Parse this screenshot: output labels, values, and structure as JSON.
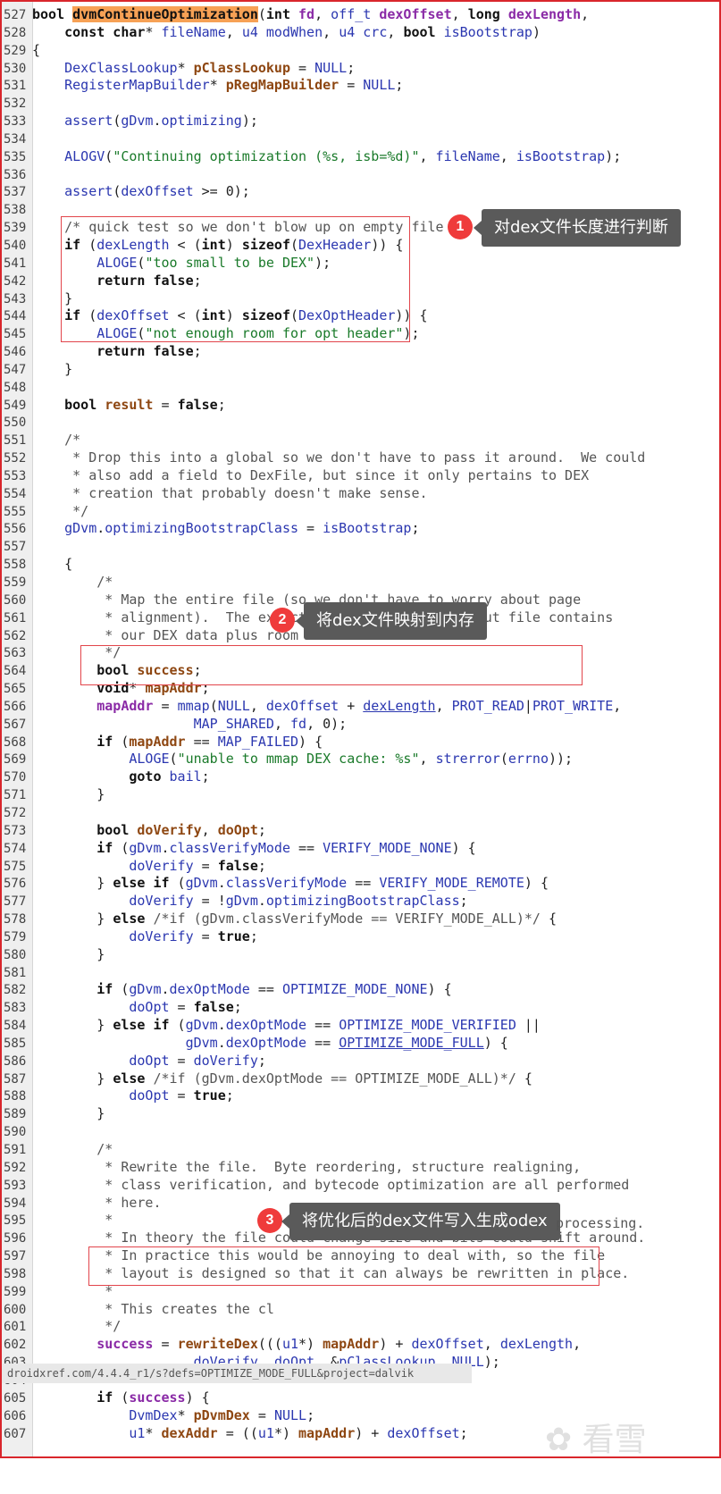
{
  "code_lines": [
    {
      "n": "527",
      "h": "<span class='k'>bool</span> <span class='fhl'>dvmContinueOptimization</span>(<span class='k'>int</span> <span class='v'>fd</span>, <span class='p'>off_t</span> <span class='v'>dexOffset</span>, <span class='k'>long</span> <span class='v'>dexLength</span>,"
    },
    {
      "n": "528",
      "h": "    <span class='k'>const char</span>* <span class='p'>fileName</span>, <span class='p'>u4 modWhen</span>, <span class='p'>u4 crc</span>, <span class='k'>bool</span> <span class='p'>isBootstrap</span>)"
    },
    {
      "n": "529",
      "h": "{"
    },
    {
      "n": "530",
      "h": "    <span class='p'>DexClassLookup</span>* <span class='f'>pClassLookup</span> = <span class='m'>NULL</span>;"
    },
    {
      "n": "531",
      "h": "    <span class='p'>RegisterMapBuilder</span>* <span class='f'>pRegMapBuilder</span> = <span class='m'>NULL</span>;"
    },
    {
      "n": "532",
      "h": ""
    },
    {
      "n": "533",
      "h": "    <span class='p'>assert</span>(<span class='p'>gDvm</span>.<span class='p'>optimizing</span>);"
    },
    {
      "n": "534",
      "h": ""
    },
    {
      "n": "535",
      "h": "    <span class='p'>ALOGV</span>(<span class='s'>\"Continuing optimization (%s, isb=%d)\"</span>, <span class='p'>fileName</span>, <span class='p'>isBootstrap</span>);"
    },
    {
      "n": "536",
      "h": ""
    },
    {
      "n": "537",
      "h": "    <span class='p'>assert</span>(<span class='p'>dexOffset</span> >= 0);"
    },
    {
      "n": "538",
      "h": ""
    },
    {
      "n": "539",
      "h": "    <span class='c'>/* quick test so we don't blow up on empty file */</span>"
    },
    {
      "n": "540",
      "h": "    <span class='k'>if</span> (<span class='p'>dexLength</span> &lt; (<span class='k'>int</span>) <span class='k'>sizeof</span>(<span class='p'>DexHeader</span>)) {"
    },
    {
      "n": "541",
      "h": "        <span class='p'>ALOGE</span>(<span class='s'>\"too small to be DEX\"</span>);"
    },
    {
      "n": "542",
      "h": "        <span class='k'>return false</span>;"
    },
    {
      "n": "543",
      "h": "    }"
    },
    {
      "n": "544",
      "h": "    <span class='k'>if</span> (<span class='p'>dexOffset</span> &lt; (<span class='k'>int</span>) <span class='k'>sizeof</span>(<span class='p'>DexOptHeader</span>)) {"
    },
    {
      "n": "545",
      "h": "        <span class='p'>ALOGE</span>(<span class='s'>\"not enough room for opt header\"</span>);"
    },
    {
      "n": "546",
      "h": "        <span class='k'>return false</span>;"
    },
    {
      "n": "547",
      "h": "    }"
    },
    {
      "n": "548",
      "h": ""
    },
    {
      "n": "549",
      "h": "    <span class='k'>bool</span> <span class='f'>result</span> = <span class='k'>false</span>;"
    },
    {
      "n": "550",
      "h": ""
    },
    {
      "n": "551",
      "h": "    <span class='c'>/*</span>"
    },
    {
      "n": "552",
      "h": "    <span class='c'> * Drop this into a global so we don't have to pass it around.  We could</span>"
    },
    {
      "n": "553",
      "h": "    <span class='c'> * also add a field to DexFile, but since it only pertains to DEX</span>"
    },
    {
      "n": "554",
      "h": "    <span class='c'> * creation that probably doesn't make sense.</span>"
    },
    {
      "n": "555",
      "h": "    <span class='c'> */</span>"
    },
    {
      "n": "556",
      "h": "    <span class='p'>gDvm</span>.<span class='p'>optimizingBootstrapClass</span> = <span class='p'>isBootstrap</span>;"
    },
    {
      "n": "557",
      "h": ""
    },
    {
      "n": "558",
      "h": "    {"
    },
    {
      "n": "559",
      "h": "        <span class='c'>/*</span>"
    },
    {
      "n": "560",
      "h": "        <span class='c'> * Map the entire file (so we don't have to worry about page</span>"
    },
    {
      "n": "561",
      "h": "        <span class='c'> * alignment).  The expectation is that the output file contains</span>"
    },
    {
      "n": "562",
      "h": "        <span class='c'> * our DEX data plus room for a small header.</span>"
    },
    {
      "n": "563",
      "h": "        <span class='c'> */</span>"
    },
    {
      "n": "564",
      "h": "        <span class='k'>bool</span> <span class='f'>success</span>;"
    },
    {
      "n": "565",
      "h": "        <span class='k'>void</span>* <span class='f'>mapAddr</span>;"
    },
    {
      "n": "566",
      "h": "        <span class='v'>mapAddr</span> = <span class='p'>mmap</span>(<span class='m'>NULL</span>, <span class='p'>dexOffset</span> + <span class='u'>dexLength</span>, <span class='m'>PROT_READ</span>|<span class='m'>PROT_WRITE</span>,"
    },
    {
      "n": "567",
      "h": "                    <span class='m'>MAP_SHARED</span>, <span class='p'>fd</span>, 0);"
    },
    {
      "n": "568",
      "h": "        <span class='k'>if</span> (<span class='f'>mapAddr</span> == <span class='m'>MAP_FAILED</span>) {"
    },
    {
      "n": "569",
      "h": "            <span class='p'>ALOGE</span>(<span class='s'>\"unable to mmap DEX cache: %s\"</span>, <span class='p'>strerror</span>(<span class='p'>errno</span>));"
    },
    {
      "n": "570",
      "h": "            <span class='k'>goto</span> <span class='p'>bail</span>;"
    },
    {
      "n": "571",
      "h": "        }"
    },
    {
      "n": "572",
      "h": ""
    },
    {
      "n": "573",
      "h": "        <span class='k'>bool</span> <span class='f'>doVerify</span>, <span class='f'>doOpt</span>;"
    },
    {
      "n": "574",
      "h": "        <span class='k'>if</span> (<span class='p'>gDvm</span>.<span class='p'>classVerifyMode</span> == <span class='m'>VERIFY_MODE_NONE</span>) {"
    },
    {
      "n": "575",
      "h": "            <span class='p'>doVerify</span> = <span class='k'>false</span>;"
    },
    {
      "n": "576",
      "h": "        } <span class='k'>else if</span> (<span class='p'>gDvm</span>.<span class='p'>classVerifyMode</span> == <span class='m'>VERIFY_MODE_REMOTE</span>) {"
    },
    {
      "n": "577",
      "h": "            <span class='p'>doVerify</span> = !<span class='p'>gDvm</span>.<span class='p'>optimizingBootstrapClass</span>;"
    },
    {
      "n": "578",
      "h": "        } <span class='k'>else</span> <span class='c'>/*if (gDvm.classVerifyMode == VERIFY_MODE_ALL)*/</span> {"
    },
    {
      "n": "579",
      "h": "            <span class='p'>doVerify</span> = <span class='k'>true</span>;"
    },
    {
      "n": "580",
      "h": "        }"
    },
    {
      "n": "581",
      "h": ""
    },
    {
      "n": "582",
      "h": "        <span class='k'>if</span> (<span class='p'>gDvm</span>.<span class='p'>dexOptMode</span> == <span class='m'>OPTIMIZE_MODE_NONE</span>) {"
    },
    {
      "n": "583",
      "h": "            <span class='p'>doOpt</span> = <span class='k'>false</span>;"
    },
    {
      "n": "584",
      "h": "        } <span class='k'>else if</span> (<span class='p'>gDvm</span>.<span class='p'>dexOptMode</span> == <span class='m'>OPTIMIZE_MODE_VERIFIED</span> ||"
    },
    {
      "n": "585",
      "h": "                   <span class='p'>gDvm</span>.<span class='p'>dexOptMode</span> == <span class='u'>OPTIMIZE_MODE_FULL</span>) {"
    },
    {
      "n": "586",
      "h": "            <span class='p'>doOpt</span> = <span class='p'>doVerify</span>;"
    },
    {
      "n": "587",
      "h": "        } <span class='k'>else</span> <span class='c'>/*if (gDvm.dexOptMode == OPTIMIZE_MODE_ALL)*/</span> {"
    },
    {
      "n": "588",
      "h": "            <span class='p'>doOpt</span> = <span class='k'>true</span>;"
    },
    {
      "n": "589",
      "h": "        }"
    },
    {
      "n": "590",
      "h": ""
    },
    {
      "n": "591",
      "h": "        <span class='c'>/*</span>"
    },
    {
      "n": "592",
      "h": "        <span class='c'> * Rewrite the file.  Byte reordering, structure realigning,</span>"
    },
    {
      "n": "593",
      "h": "        <span class='c'> * class verification, and bytecode optimization are all performed</span>"
    },
    {
      "n": "594",
      "h": "        <span class='c'> * here.</span>"
    },
    {
      "n": "595",
      "h": "        <span class='c'> *</span>"
    },
    {
      "n": "596",
      "h": "        <span class='c'> * In theory the file could change size and bits could shift around.</span>"
    },
    {
      "n": "597",
      "h": "        <span class='c'> * In practice this would be annoying to deal with, so the file</span>"
    },
    {
      "n": "598",
      "h": "        <span class='c'> * layout is designed so that it can always be rewritten in place.</span>"
    },
    {
      "n": "599",
      "h": "        <span class='c'> *</span>"
    },
    {
      "n": "600",
      "h": "        <span class='c'> * This creates the cl</span>"
    },
    {
      "n": "601",
      "h": "        <span class='c'> */</span>"
    },
    {
      "n": "602",
      "h": "        <span class='v'>success</span> = <span class='f'>rewriteDex</span>(((<span class='p'>u1</span>*) <span class='f'>mapAddr</span>) + <span class='p'>dexOffset</span>, <span class='p'>dexLength</span>,"
    },
    {
      "n": "603",
      "h": "                    <span class='p'>doVerify</span>, <span class='p'>doOpt</span>, &amp;<span class='p'>pClassLookup</span>, <span class='m'>NULL</span>);"
    },
    {
      "n": "604",
      "h": ""
    },
    {
      "n": "605",
      "h": "        <span class='k'>if</span> (<span class='v'>success</span>) {"
    },
    {
      "n": "606",
      "h": "            <span class='p'>DvmDex</span>* <span class='f'>pDvmDex</span> = <span class='m'>NULL</span>;"
    },
    {
      "n": "607",
      "h": "            <span class='p'>u1</span>* <span class='f'>dexAddr</span> = ((<span class='p'>u1</span>*) <span class='f'>mapAddr</span>) + <span class='p'>dexOffset</span>;"
    }
  ],
  "annotations": [
    {
      "num": "1",
      "text": "对dex文件长度进行判断"
    },
    {
      "num": "2",
      "text": "将dex文件映射到内存"
    },
    {
      "num": "3",
      "text": "将优化后的dex文件写入生成odex"
    }
  ],
  "line_600_tail": "processing.",
  "url_text": "droidxref.com/4.4.4_r1/s?defs=OPTIMIZE_MODE_FULL&project=dalvik",
  "watermark": "看雪"
}
